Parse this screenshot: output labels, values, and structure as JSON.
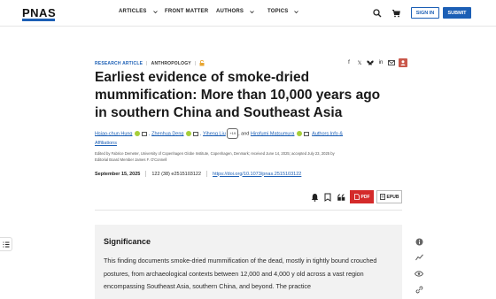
{
  "header": {
    "logo": "PNAS",
    "nav": [
      {
        "label": "ARTICLES",
        "has_dropdown": true
      },
      {
        "label": "FRONT MATTER",
        "has_dropdown": false
      },
      {
        "label": "AUTHORS",
        "has_dropdown": true
      },
      {
        "label": "TOPICS",
        "has_dropdown": true
      }
    ],
    "sign_in": "SIGN IN",
    "submit": "SUBMIT",
    "accent": "#1c5fb5"
  },
  "article": {
    "type": "RESEARCH ARTICLE",
    "subject": "ANTHROPOLOGY",
    "title": "Earliest evidence of smoke-dried mummification: More than 10,000 years ago in southern China and Southeast Asia",
    "authors": [
      {
        "name": "Hsiao-chun Hung"
      },
      {
        "name": "Zhenhua Deng"
      },
      {
        "name": "Yiheng Liu"
      }
    ],
    "more_authors": "+19",
    "and_text": ", and",
    "last_author": "Hirofumi Matsumura",
    "affiliations_link": "Authors Info & Affiliations",
    "edited_by": "Edited by Fabrice Demeter, University of Copenhagen Globe Institute, Copenhagen, Denmark; received June 14, 2025; accepted July 23, 2025 by Editorial Board Member James F. O'Connell",
    "pub_date": "September 15, 2025",
    "volume": "122 (38) e2515103122",
    "doi": "https://doi.org/10.1073/pnas.2515103122",
    "pdf_label": "PDF",
    "epub_label": "EPUB"
  },
  "significance": {
    "heading": "Significance",
    "text": "This finding documents smoke-dried mummification of the dead, mostly in tightly bound crouched postures, from archaeological contexts between 12,000 and 4,000 y old across a vast region encompassing Southeast Asia, southern China, and beyond. The practice"
  },
  "icons": {
    "search": "search-icon",
    "cart": "cart-icon",
    "pdf_color": "#d42a2a",
    "orcid_color": "#a6ce39"
  }
}
